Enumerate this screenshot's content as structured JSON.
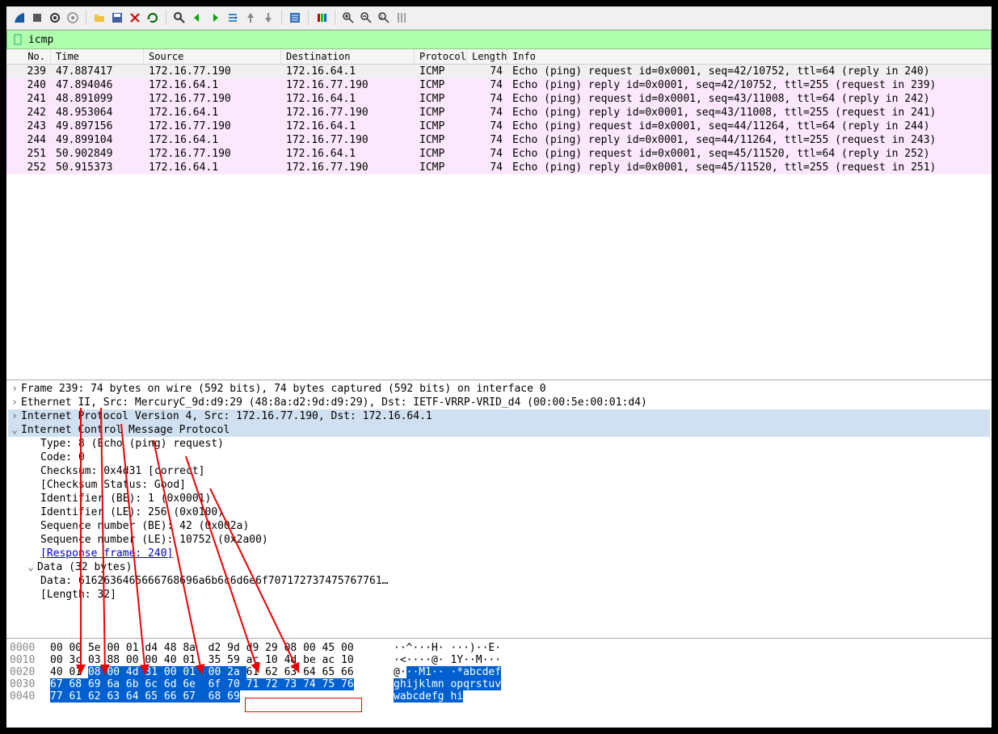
{
  "filter": {
    "value": "icmp"
  },
  "columns": {
    "no": "No.",
    "time": "Time",
    "src": "Source",
    "dst": "Destination",
    "proto": "Protocol",
    "len": "Length",
    "info": "Info"
  },
  "packets": [
    {
      "no": "239",
      "time": "47.887417",
      "src": "172.16.77.190",
      "dst": "172.16.64.1",
      "proto": "ICMP",
      "len": "74",
      "info": "Echo (ping) request  id=0x0001, seq=42/10752, ttl=64 (reply in 240)",
      "cls": "first"
    },
    {
      "no": "240",
      "time": "47.894046",
      "src": "172.16.64.1",
      "dst": "172.16.77.190",
      "proto": "ICMP",
      "len": "74",
      "info": "Echo (ping) reply    id=0x0001, seq=42/10752, ttl=255 (request in 239)",
      "cls": "rep"
    },
    {
      "no": "241",
      "time": "48.891099",
      "src": "172.16.77.190",
      "dst": "172.16.64.1",
      "proto": "ICMP",
      "len": "74",
      "info": "Echo (ping) request  id=0x0001, seq=43/11008, ttl=64 (reply in 242)",
      "cls": "req"
    },
    {
      "no": "242",
      "time": "48.953064",
      "src": "172.16.64.1",
      "dst": "172.16.77.190",
      "proto": "ICMP",
      "len": "74",
      "info": "Echo (ping) reply    id=0x0001, seq=43/11008, ttl=255 (request in 241)",
      "cls": "rep"
    },
    {
      "no": "243",
      "time": "49.897156",
      "src": "172.16.77.190",
      "dst": "172.16.64.1",
      "proto": "ICMP",
      "len": "74",
      "info": "Echo (ping) request  id=0x0001, seq=44/11264, ttl=64 (reply in 244)",
      "cls": "req"
    },
    {
      "no": "244",
      "time": "49.899104",
      "src": "172.16.64.1",
      "dst": "172.16.77.190",
      "proto": "ICMP",
      "len": "74",
      "info": "Echo (ping) reply    id=0x0001, seq=44/11264, ttl=255 (request in 243)",
      "cls": "rep"
    },
    {
      "no": "251",
      "time": "50.902849",
      "src": "172.16.77.190",
      "dst": "172.16.64.1",
      "proto": "ICMP",
      "len": "74",
      "info": "Echo (ping) request  id=0x0001, seq=45/11520, ttl=64 (reply in 252)",
      "cls": "req"
    },
    {
      "no": "252",
      "time": "50.915373",
      "src": "172.16.64.1",
      "dst": "172.16.77.190",
      "proto": "ICMP",
      "len": "74",
      "info": "Echo (ping) reply    id=0x0001, seq=45/11520, ttl=255 (request in 251)",
      "cls": "rep"
    }
  ],
  "details": {
    "frame": "Frame 239: 74 bytes on wire (592 bits), 74 bytes captured (592 bits) on interface 0",
    "eth": "Ethernet II, Src: MercuryC_9d:d9:29 (48:8a:d2:9d:d9:29), Dst: IETF-VRRP-VRID_d4 (00:00:5e:00:01:d4)",
    "ip": "Internet Protocol Version 4, Src: 172.16.77.190, Dst: 172.16.64.1",
    "icmp": "Internet Control Message Protocol",
    "type": "Type: 8 (Echo (ping) request)",
    "code": "Code: 0",
    "cksum": "Checksum: 0x4d31 [correct]",
    "ckstat": "[Checksum Status: Good]",
    "idbe": "Identifier (BE): 1 (0x0001)",
    "idle": "Identifier (LE): 256 (0x0100)",
    "seqbe": "Sequence number (BE): 42 (0x002a)",
    "seqle": "Sequence number (LE): 10752 (0x2a00)",
    "resp": "[Response frame: 240]",
    "data": "Data (32 bytes)",
    "databytes": "Data: 6162636465666768696a6b6c6d6e6f707172737475767761…",
    "datalen": "[Length: 32]"
  },
  "hex": [
    {
      "off": "0000",
      "b": "00 00 5e 00 01 d4 48 8a  d2 9d d9 29 08 00 45 00",
      "a": "··^···H· ···)··E·"
    },
    {
      "off": "0010",
      "b": "00 3c 03 88 00 00 40 01  35 59 ac 10 4d be ac 10",
      "a": "·<····@· 1Y··M···"
    },
    {
      "off": "0020",
      "b": "40 01 ",
      "bs": "08 00 4d 31 00 01  00 2a ",
      "b2": "61 62 63 64 65 66",
      "a": "@·",
      "as": "··M1·· ·*",
      "a2": "abcdef"
    },
    {
      "off": "0030",
      "bs": "67 68 69 6a 6b 6c 6d 6e  6f 70 71 72 73 74 75 76",
      "as": "ghijklmn opqrstuv"
    },
    {
      "off": "0040",
      "bs": "77 61 62 63 64 65 66 67  68 69",
      "as": "wabcdefg hi"
    }
  ],
  "toolbar_icons": [
    "shark-fin",
    "stop",
    "restart",
    "settings",
    "folder",
    "save",
    "close",
    "reload",
    "search",
    "back",
    "forward",
    "goto",
    "up",
    "down",
    "autoscroll",
    "colorize",
    "zoom-in",
    "zoom-out",
    "zoom-fit",
    "columns"
  ]
}
